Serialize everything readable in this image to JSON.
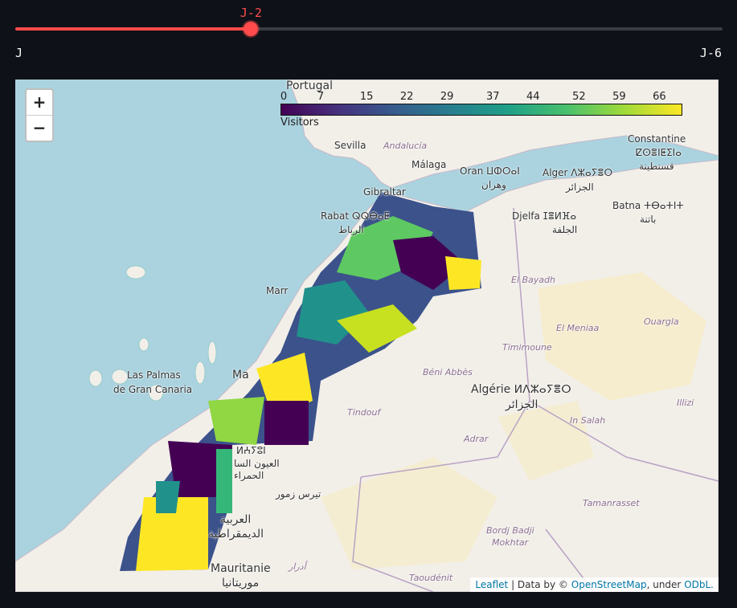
{
  "slider": {
    "current_label": "J-2",
    "min_label": "J",
    "max_label": "J-6",
    "value": 2,
    "min": 0,
    "max": 6,
    "accent_color": "#ff4b4b"
  },
  "map": {
    "zoom_in_label": "+",
    "zoom_out_label": "−",
    "legend": {
      "ticks": [
        "0",
        "7",
        "15",
        "22",
        "29",
        "37",
        "44",
        "52",
        "59",
        "66"
      ],
      "tick_values": [
        0,
        7,
        15,
        22,
        29,
        37,
        44,
        52,
        59,
        66
      ],
      "max": 70,
      "caption": "Visitors",
      "colormap": "viridis"
    },
    "attribution": {
      "leaflet": "Leaflet",
      "sep": " | Data by © ",
      "osm": "OpenStreetMap",
      "under": ", under ",
      "license": "ODbL."
    },
    "places": {
      "portugal": "Portugal",
      "sevilla": "Sevilla",
      "andalucia": "Andalucía",
      "malaga": "Málaga",
      "gibraltar": "Gibraltar",
      "oran": "Oran ⵡⵀⵔⴰⵏ",
      "oran_ar": "وهران",
      "alger": "Alger ⴷⵣⴰⵢⴻⵔ",
      "alger_ar": "الجزائر",
      "constantine": "Constantine",
      "constantine_ber": "ⵇⵙⴻⵏⵟⵉⵏⴰ",
      "constantine_ar": "قسنطينة",
      "rabat": "Rabat ⵕⵕⴱⴰⵟ",
      "rabat_ar": "الرباط",
      "djelfa": "Djelfa ⵊⴻⵍⴼⴰ",
      "djelfa_ar": "الجلفة",
      "batna": "Batna ⵜⴱⴰⵜⵏⵜ",
      "batna_ar": "باتنة",
      "el_bayadh": "El Bayadh",
      "el_meniaa": "El Meniaa",
      "ouargla": "Ouargla",
      "timimoune": "Timimoune",
      "beni_abbes": "Béni Abbès",
      "algerie": "Algérie ⵍⴷⵣⴰⵢⴻⵔ",
      "algerie_ar": "الجزائر",
      "tindouf": "Tindouf",
      "in_salah": "In Salah",
      "illizi": "Illizi",
      "adrar": "Adrar",
      "tamanrasset": "Tamanrasset",
      "las_palmas": "Las Palmas",
      "gran_canaria": "de Gran Canaria",
      "mar": "Marr",
      "ma": "Ma",
      "laayoune": "ⵍⵄⵢⵓⵏ",
      "laayoune_ar": "العيون السا",
      "hamra": "الحمراء",
      "tiris": "تيرس زمور",
      "arabia": "العربية",
      "dimoqratia": "الديمقراطية",
      "bordj": "Bordj Badji",
      "mokhtar": "Mokhtar",
      "mauritanie": "Mauritanie",
      "mauritanie_ar": "موريتانيا",
      "adrar_ar": "أدرار",
      "taoudenit": "Taoudénit"
    }
  }
}
